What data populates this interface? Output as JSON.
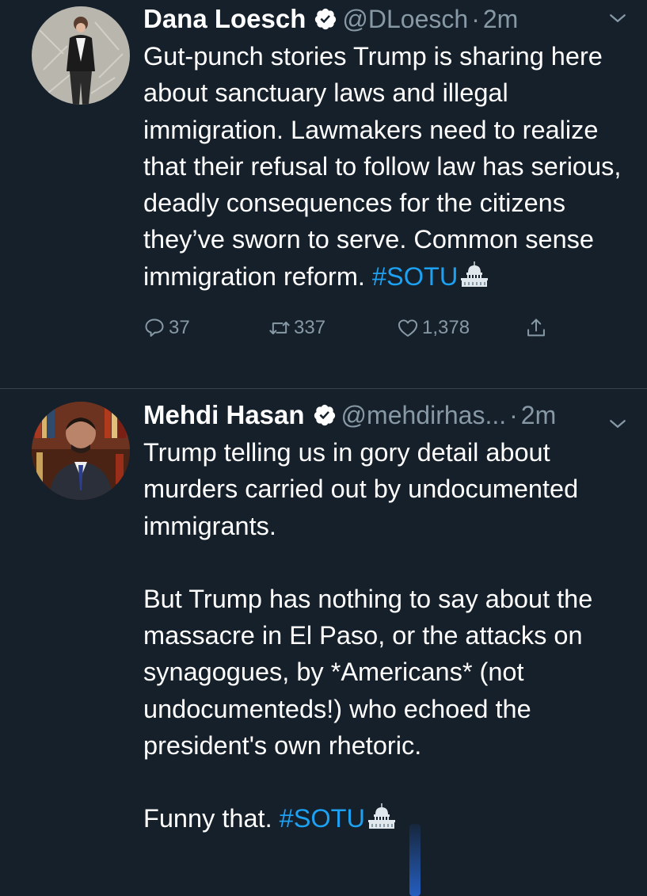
{
  "colors": {
    "background": "#15202b",
    "text": "#ffffff",
    "secondary": "#8899a6",
    "link": "#1da1f2",
    "divider": "#38444d"
  },
  "tweets": [
    {
      "name": "Dana Loesch",
      "handle": "@DLoesch",
      "separator": "·",
      "time": "2m",
      "paragraphs": [
        "Gut-punch stories Trump is sharing here about sanctuary laws and illegal immigration. Lawmakers need to realize that their refusal to follow law has serious, deadly consequences for the citizens they’ve sworn to serve. Common sense immigration reform. "
      ],
      "hashtag": "#SOTU",
      "replies": "37",
      "retweets": "337",
      "likes": "1,378"
    },
    {
      "name": "Mehdi Hasan",
      "handle": "@mehdirhas...",
      "separator": "·",
      "time": "2m",
      "paragraphs": [
        "Trump telling us in gory detail about murders carried out by undocumented immigrants.",
        "But Trump has nothing to say about the massacre in El Paso, or the attacks on synagogues, by *Americans* (not undocumenteds!) who echoed the president's own rhetoric.",
        "Funny that. "
      ],
      "hashtag": "#SOTU"
    }
  ]
}
